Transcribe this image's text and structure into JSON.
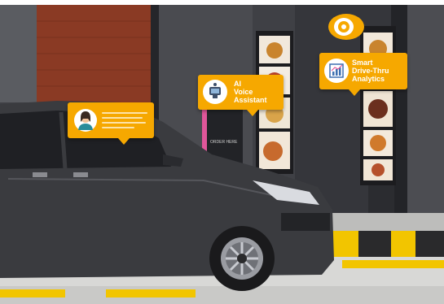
{
  "storefront_sign": "ORDER HERE",
  "callouts": [
    {
      "icon": "user-avatar-icon",
      "title": ""
    },
    {
      "icon": "voice-assistant-device-icon",
      "title": "AI\nVoice\nAssistant"
    },
    {
      "icon": "analytics-chart-icon",
      "title": "Smart\nDrive-Thru\nAnalytics"
    }
  ],
  "floating_icon": "camera-lens-icon",
  "colors": {
    "accent": "#f6a800",
    "car": "#3a3b3f",
    "curb_yellow": "#f2c500",
    "wall_dark": "#2c2d31",
    "brick": "#8a3a24"
  }
}
